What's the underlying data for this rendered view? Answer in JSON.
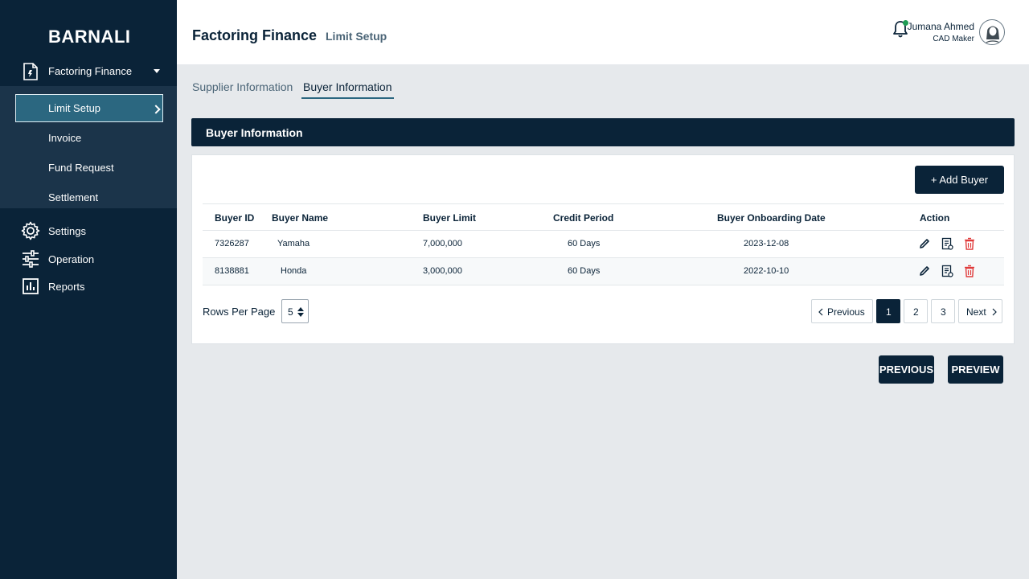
{
  "app": {
    "brand": "BARNALI"
  },
  "sidebar": {
    "parent": {
      "label": "Factoring Finance",
      "icon": "document-icon"
    },
    "submenu": [
      {
        "label": "Limit Setup",
        "active": true
      },
      {
        "label": "Invoice"
      },
      {
        "label": "Fund Request"
      },
      {
        "label": "Settlement",
        "has_children": true
      }
    ],
    "items": [
      {
        "label": "Settings",
        "icon": "gear-icon"
      },
      {
        "label": "Operation",
        "icon": "sliders-icon"
      },
      {
        "label": "Reports",
        "icon": "chart-icon"
      }
    ]
  },
  "header": {
    "title": "Factoring Finance",
    "subtitle": "Limit Setup",
    "user": {
      "name": "Jumana Ahmed",
      "role": "CAD Maker"
    }
  },
  "tabs": [
    {
      "label": "Supplier Information",
      "active": false
    },
    {
      "label": "Buyer Information",
      "active": true
    }
  ],
  "section": {
    "title": "Buyer Information",
    "add_button": "+ Add Buyer"
  },
  "table": {
    "columns": [
      "Buyer ID",
      "Buyer Name",
      "Buyer Limit",
      "Credit Period",
      "Buyer Onboarding Date",
      "Action"
    ],
    "rows": [
      {
        "id": "7326287",
        "name": "Yamaha",
        "limit": "7,000,000",
        "period": "60 Days",
        "date": "2023-12-08"
      },
      {
        "id": "8138881",
        "name": "Honda",
        "limit": "3,000,000",
        "period": "60 Days",
        "date": "2022-10-10"
      }
    ]
  },
  "pagination": {
    "rows_label": "Rows Per Page",
    "rows_value": "5",
    "previous": "Previous",
    "next": "Next",
    "pages": [
      "1",
      "2",
      "3"
    ],
    "current": "1"
  },
  "footer": {
    "previous": "PREVIOUS",
    "preview": "PREVIEW"
  },
  "colors": {
    "navy": "#0a2338",
    "teal": "#2b6780",
    "delete": "#e03a3a",
    "notify": "#1f9d55"
  }
}
